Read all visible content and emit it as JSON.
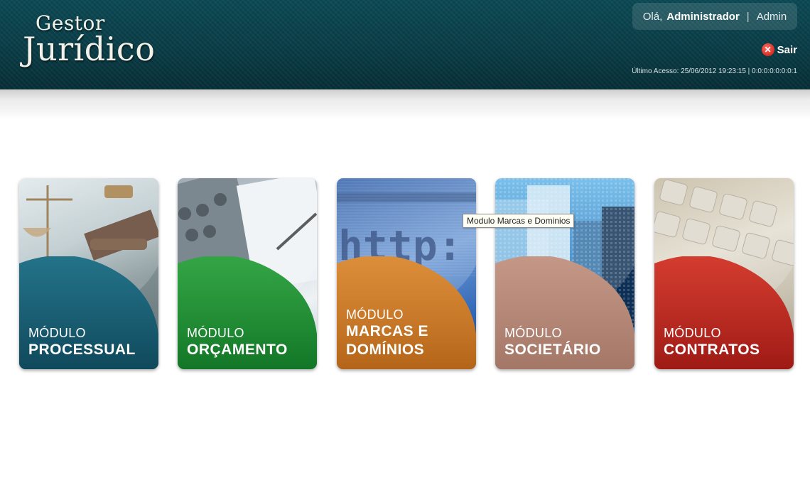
{
  "header": {
    "logo_line1": "Gestor",
    "logo_line2": "Jurídico",
    "greeting": "Olá,",
    "user_name": "Administrador",
    "separator": "|",
    "admin_link": "Admin",
    "logout_label": "Sair",
    "logout_icon": "close-circle-icon",
    "last_access": "Último Acesso: 25/06/2012 19:23:15 | 0:0:0:0:0:0:0:1"
  },
  "modules": [
    {
      "small": "MÓDULO",
      "big_line1": "PROCESSUAL",
      "big_line2": "",
      "color": "#1a5f73",
      "image": "justice-scale-gavel-image"
    },
    {
      "small": "MÓDULO",
      "big_line1": "ORÇAMENTO",
      "big_line2": "",
      "color": "#239337",
      "image": "calculator-cashflow-image"
    },
    {
      "small": "MÓDULO",
      "big_line1": "MARCAS E",
      "big_line2": "DOMÍNIOS",
      "color": "#d07d28",
      "image": "http-screen-image"
    },
    {
      "small": "MÓDULO",
      "big_line1": "SOCIETÁRIO",
      "big_line2": "",
      "color": "#b88a78",
      "image": "office-buildings-image"
    },
    {
      "small": "MÓDULO",
      "big_line1": "CONTRATOS",
      "big_line2": "",
      "color": "#c1281f",
      "image": "keyboard-image"
    }
  ],
  "tooltip": "Modulo Marcas e Dominios"
}
